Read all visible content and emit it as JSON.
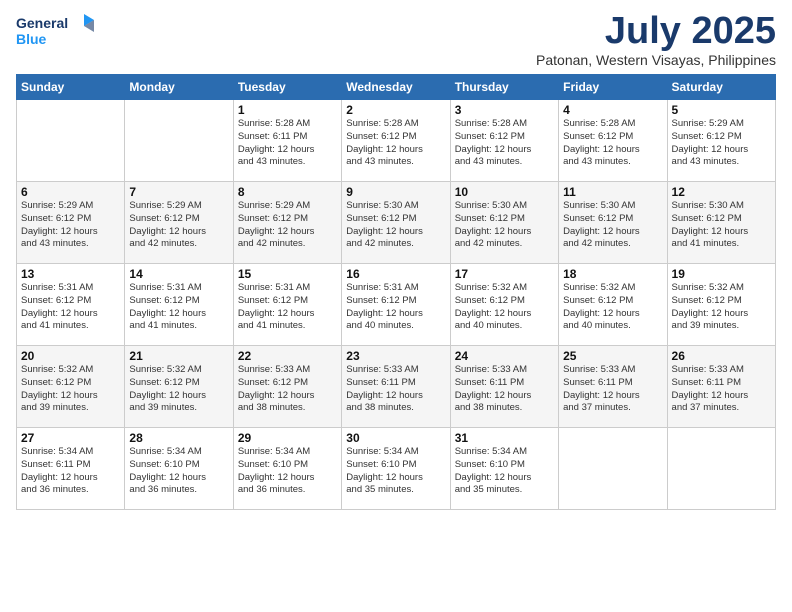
{
  "logo": {
    "line1": "General",
    "line2": "Blue"
  },
  "title": "July 2025",
  "location": "Patonan, Western Visayas, Philippines",
  "weekdays": [
    "Sunday",
    "Monday",
    "Tuesday",
    "Wednesday",
    "Thursday",
    "Friday",
    "Saturday"
  ],
  "weeks": [
    [
      {
        "day": "",
        "info": ""
      },
      {
        "day": "",
        "info": ""
      },
      {
        "day": "1",
        "info": "Sunrise: 5:28 AM\nSunset: 6:11 PM\nDaylight: 12 hours\nand 43 minutes."
      },
      {
        "day": "2",
        "info": "Sunrise: 5:28 AM\nSunset: 6:12 PM\nDaylight: 12 hours\nand 43 minutes."
      },
      {
        "day": "3",
        "info": "Sunrise: 5:28 AM\nSunset: 6:12 PM\nDaylight: 12 hours\nand 43 minutes."
      },
      {
        "day": "4",
        "info": "Sunrise: 5:28 AM\nSunset: 6:12 PM\nDaylight: 12 hours\nand 43 minutes."
      },
      {
        "day": "5",
        "info": "Sunrise: 5:29 AM\nSunset: 6:12 PM\nDaylight: 12 hours\nand 43 minutes."
      }
    ],
    [
      {
        "day": "6",
        "info": "Sunrise: 5:29 AM\nSunset: 6:12 PM\nDaylight: 12 hours\nand 43 minutes."
      },
      {
        "day": "7",
        "info": "Sunrise: 5:29 AM\nSunset: 6:12 PM\nDaylight: 12 hours\nand 42 minutes."
      },
      {
        "day": "8",
        "info": "Sunrise: 5:29 AM\nSunset: 6:12 PM\nDaylight: 12 hours\nand 42 minutes."
      },
      {
        "day": "9",
        "info": "Sunrise: 5:30 AM\nSunset: 6:12 PM\nDaylight: 12 hours\nand 42 minutes."
      },
      {
        "day": "10",
        "info": "Sunrise: 5:30 AM\nSunset: 6:12 PM\nDaylight: 12 hours\nand 42 minutes."
      },
      {
        "day": "11",
        "info": "Sunrise: 5:30 AM\nSunset: 6:12 PM\nDaylight: 12 hours\nand 42 minutes."
      },
      {
        "day": "12",
        "info": "Sunrise: 5:30 AM\nSunset: 6:12 PM\nDaylight: 12 hours\nand 41 minutes."
      }
    ],
    [
      {
        "day": "13",
        "info": "Sunrise: 5:31 AM\nSunset: 6:12 PM\nDaylight: 12 hours\nand 41 minutes."
      },
      {
        "day": "14",
        "info": "Sunrise: 5:31 AM\nSunset: 6:12 PM\nDaylight: 12 hours\nand 41 minutes."
      },
      {
        "day": "15",
        "info": "Sunrise: 5:31 AM\nSunset: 6:12 PM\nDaylight: 12 hours\nand 41 minutes."
      },
      {
        "day": "16",
        "info": "Sunrise: 5:31 AM\nSunset: 6:12 PM\nDaylight: 12 hours\nand 40 minutes."
      },
      {
        "day": "17",
        "info": "Sunrise: 5:32 AM\nSunset: 6:12 PM\nDaylight: 12 hours\nand 40 minutes."
      },
      {
        "day": "18",
        "info": "Sunrise: 5:32 AM\nSunset: 6:12 PM\nDaylight: 12 hours\nand 40 minutes."
      },
      {
        "day": "19",
        "info": "Sunrise: 5:32 AM\nSunset: 6:12 PM\nDaylight: 12 hours\nand 39 minutes."
      }
    ],
    [
      {
        "day": "20",
        "info": "Sunrise: 5:32 AM\nSunset: 6:12 PM\nDaylight: 12 hours\nand 39 minutes."
      },
      {
        "day": "21",
        "info": "Sunrise: 5:32 AM\nSunset: 6:12 PM\nDaylight: 12 hours\nand 39 minutes."
      },
      {
        "day": "22",
        "info": "Sunrise: 5:33 AM\nSunset: 6:12 PM\nDaylight: 12 hours\nand 38 minutes."
      },
      {
        "day": "23",
        "info": "Sunrise: 5:33 AM\nSunset: 6:11 PM\nDaylight: 12 hours\nand 38 minutes."
      },
      {
        "day": "24",
        "info": "Sunrise: 5:33 AM\nSunset: 6:11 PM\nDaylight: 12 hours\nand 38 minutes."
      },
      {
        "day": "25",
        "info": "Sunrise: 5:33 AM\nSunset: 6:11 PM\nDaylight: 12 hours\nand 37 minutes."
      },
      {
        "day": "26",
        "info": "Sunrise: 5:33 AM\nSunset: 6:11 PM\nDaylight: 12 hours\nand 37 minutes."
      }
    ],
    [
      {
        "day": "27",
        "info": "Sunrise: 5:34 AM\nSunset: 6:11 PM\nDaylight: 12 hours\nand 36 minutes."
      },
      {
        "day": "28",
        "info": "Sunrise: 5:34 AM\nSunset: 6:10 PM\nDaylight: 12 hours\nand 36 minutes."
      },
      {
        "day": "29",
        "info": "Sunrise: 5:34 AM\nSunset: 6:10 PM\nDaylight: 12 hours\nand 36 minutes."
      },
      {
        "day": "30",
        "info": "Sunrise: 5:34 AM\nSunset: 6:10 PM\nDaylight: 12 hours\nand 35 minutes."
      },
      {
        "day": "31",
        "info": "Sunrise: 5:34 AM\nSunset: 6:10 PM\nDaylight: 12 hours\nand 35 minutes."
      },
      {
        "day": "",
        "info": ""
      },
      {
        "day": "",
        "info": ""
      }
    ]
  ]
}
